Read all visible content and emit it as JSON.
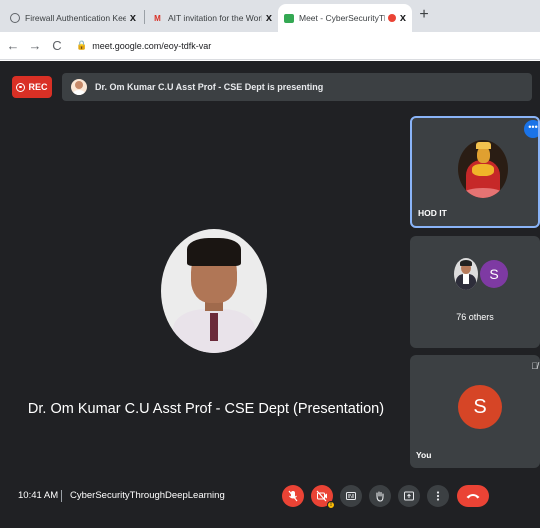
{
  "browser": {
    "tabs": [
      {
        "title": "Firewall Authentication Keepalive",
        "close": "x"
      },
      {
        "title": "AIT invitation for the Workshop",
        "close": "x"
      },
      {
        "title": "Meet - CyberSecurityThroug",
        "close": "x"
      }
    ],
    "new_tab": "+",
    "url": "meet.google.com/eoy-tdfk-var"
  },
  "meet": {
    "rec_label": "REC",
    "presenting_text": "Dr. Om Kumar C.U Asst Prof - CSE Dept is presenting",
    "main_participant": "Dr. Om Kumar C.U Asst Prof - CSE Dept (Presentation)",
    "tiles": [
      {
        "label": "HOD IT"
      },
      {
        "avatar_letter": "S",
        "label": "76 others"
      },
      {
        "avatar_letter": "S",
        "label": "You"
      }
    ],
    "time": "10:41 AM",
    "separator": "|",
    "meeting_name": "CyberSecurityThroughDeepLearning"
  },
  "colors": {
    "meet_bg": "#202124",
    "tile_bg": "#3c4043",
    "rec_red": "#d93025",
    "active_blue": "#8ab4f8",
    "purple_avatar": "#7e3aa3",
    "orange_avatar": "#d64526"
  },
  "icons": [
    "back-arrow-icon",
    "forward-arrow-icon",
    "reload-icon",
    "lock-icon",
    "mic-off-icon",
    "camera-off-icon",
    "captions-icon",
    "hand-raise-icon",
    "present-icon",
    "more-options-icon",
    "end-call-icon"
  ]
}
